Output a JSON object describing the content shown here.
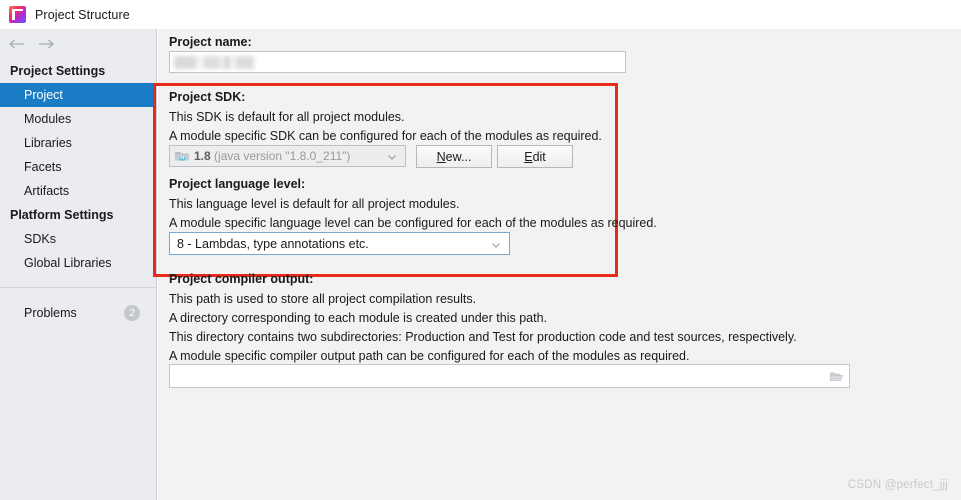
{
  "window": {
    "title": "Project Structure",
    "app_icon": "intellij-idea-icon"
  },
  "nav": {
    "back_icon": "arrow-left-icon",
    "forward_icon": "arrow-right-icon"
  },
  "sidebar": {
    "groups": [
      {
        "title": "Project Settings",
        "items": [
          {
            "label": "Project",
            "selected": true
          },
          {
            "label": "Modules",
            "selected": false
          },
          {
            "label": "Libraries",
            "selected": false
          },
          {
            "label": "Facets",
            "selected": false
          },
          {
            "label": "Artifacts",
            "selected": false
          }
        ]
      },
      {
        "title": "Platform Settings",
        "items": [
          {
            "label": "SDKs",
            "selected": false
          },
          {
            "label": "Global Libraries",
            "selected": false
          }
        ]
      }
    ],
    "problems": {
      "label": "Problems",
      "count": "2"
    }
  },
  "main": {
    "project_name": {
      "label": "Project name:",
      "value": "",
      "redacted": true
    },
    "project_sdk": {
      "label": "Project SDK:",
      "description_line1": "This SDK is default for all project modules.",
      "description_line2": "A module specific SDK can be configured for each of the modules as required.",
      "combo_icon": "java-sdk-folder-icon",
      "combo_value_name": "1.8",
      "combo_value_detail": "(java version \"1.8.0_211\")",
      "combo_chevron": "chevron-down-icon",
      "new_button": {
        "prefix": "",
        "mnemonic": "N",
        "suffix": "ew..."
      },
      "edit_button": {
        "prefix": "",
        "mnemonic": "E",
        "suffix": "dit"
      }
    },
    "project_language_level": {
      "label": "Project language level:",
      "description_line1": "This language level is default for all project modules.",
      "description_line2": "A module specific language level can be configured for each of the modules as required.",
      "combo_value": "8 - Lambdas, type annotations etc.",
      "combo_chevron": "chevron-down-icon"
    },
    "project_compiler_output": {
      "label": "Project compiler output:",
      "description_line1": "This path is used to store all project compilation results.",
      "description_line2": "A directory corresponding to each module is created under this path.",
      "description_line3": "This directory contains two subdirectories: Production and Test for production code and test sources, respectively.",
      "description_line4": "A module specific compiler output path can be configured for each of the modules as required.",
      "value": "",
      "placeholder": "",
      "browse_icon": "folder-open-icon"
    },
    "highlight_box_color": "#e8291c"
  },
  "watermark": {
    "text": "CSDN @perfect_jjj"
  },
  "colors": {
    "selection": "#1a7cc4",
    "sidebar_bg": "#ebecf0",
    "panel_bg": "#f2f2f2",
    "highlight": "#e8291c"
  }
}
